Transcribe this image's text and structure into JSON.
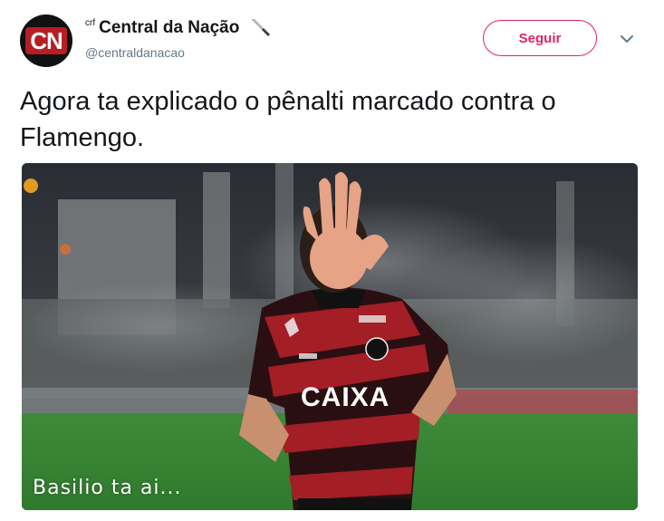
{
  "author": {
    "prefix": "crf",
    "display_name": "Central da Nação",
    "handle": "@centraldanacao",
    "avatar_text": "CN"
  },
  "follow_label": "Seguir",
  "tweet": {
    "text": "Agora ta explicado o pênalti marcado contra o Flamengo."
  },
  "media": {
    "caption": "Basilio ta ai...",
    "jersey_sponsor": "CAIXA"
  },
  "colors": {
    "accent": "#e0245e",
    "text": "#14171a",
    "muted": "#657786"
  },
  "icons": {
    "knife": "knife-icon",
    "more": "chevron-down-icon"
  }
}
